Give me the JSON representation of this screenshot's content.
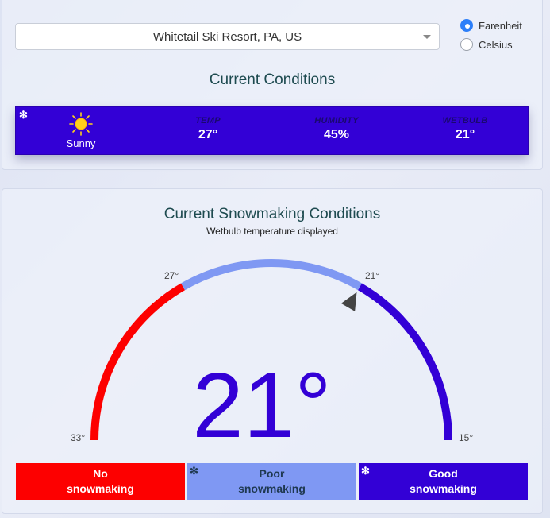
{
  "location": {
    "selected": "Whitetail Ski Resort, PA, US"
  },
  "units": {
    "options": [
      "Farenheit",
      "Celsius"
    ],
    "selected": "Farenheit"
  },
  "current": {
    "title": "Current Conditions",
    "weather_icon": "sun-icon",
    "weather": "Sunny",
    "temp_label": "TEMP",
    "temp": "27°",
    "humidity_label": "HUMIDITY",
    "humidity": "45%",
    "wetbulb_label": "WETBULB",
    "wetbulb": "21°",
    "bar_color": "#3300d6"
  },
  "snowmaking": {
    "title": "Current Snowmaking Conditions",
    "subtitle": "Wetbulb temperature displayed",
    "value": "21°",
    "gauge": {
      "min": 15,
      "max": 33,
      "current": 21,
      "thresholds": [
        27,
        21
      ]
    },
    "tick_labels": {
      "t33": "33°",
      "t27": "27°",
      "t21": "21°",
      "t15": "15°"
    },
    "colors": {
      "no": "#fd0000",
      "poor": "#7f98f3",
      "good": "#3300d6"
    },
    "legend": {
      "no": {
        "line1": "No",
        "line2": "snowmaking"
      },
      "poor": {
        "line1": "Poor",
        "line2": "snowmaking"
      },
      "good": {
        "line1": "Good",
        "line2": "snowmaking"
      }
    }
  }
}
